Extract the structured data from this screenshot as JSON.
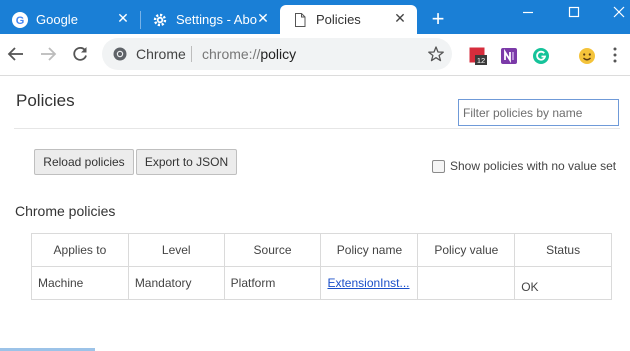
{
  "tabs": [
    {
      "title": "Google",
      "close": "✕"
    },
    {
      "title": "Settings - Abo",
      "close": "✕"
    },
    {
      "title": "Policies",
      "close": "✕"
    }
  ],
  "new_tab_label": "+",
  "omnibox": {
    "chip": "Chrome",
    "url_scheme": "chrome://",
    "url_host": "policy"
  },
  "extensions": {
    "calendar_badge": "12"
  },
  "page": {
    "title": "Policies",
    "filter_placeholder": "Filter policies by name",
    "reload_button": "Reload policies",
    "export_button": "Export to JSON",
    "show_no_value_label": "Show policies with no value set",
    "section_title": "Chrome policies"
  },
  "table": {
    "headers": [
      "Applies to",
      "Level",
      "Source",
      "Policy name",
      "Policy value",
      "Status"
    ],
    "rows": [
      {
        "applies_to": "Machine",
        "level": "Mandatory",
        "source": "Platform",
        "policy_name": "ExtensionInst...",
        "policy_value": "",
        "status": "OK"
      }
    ]
  },
  "colors": {
    "tab_strip": "#1a7fd6",
    "link": "#1a4fc9",
    "filter_border": "#6f9ad8"
  }
}
